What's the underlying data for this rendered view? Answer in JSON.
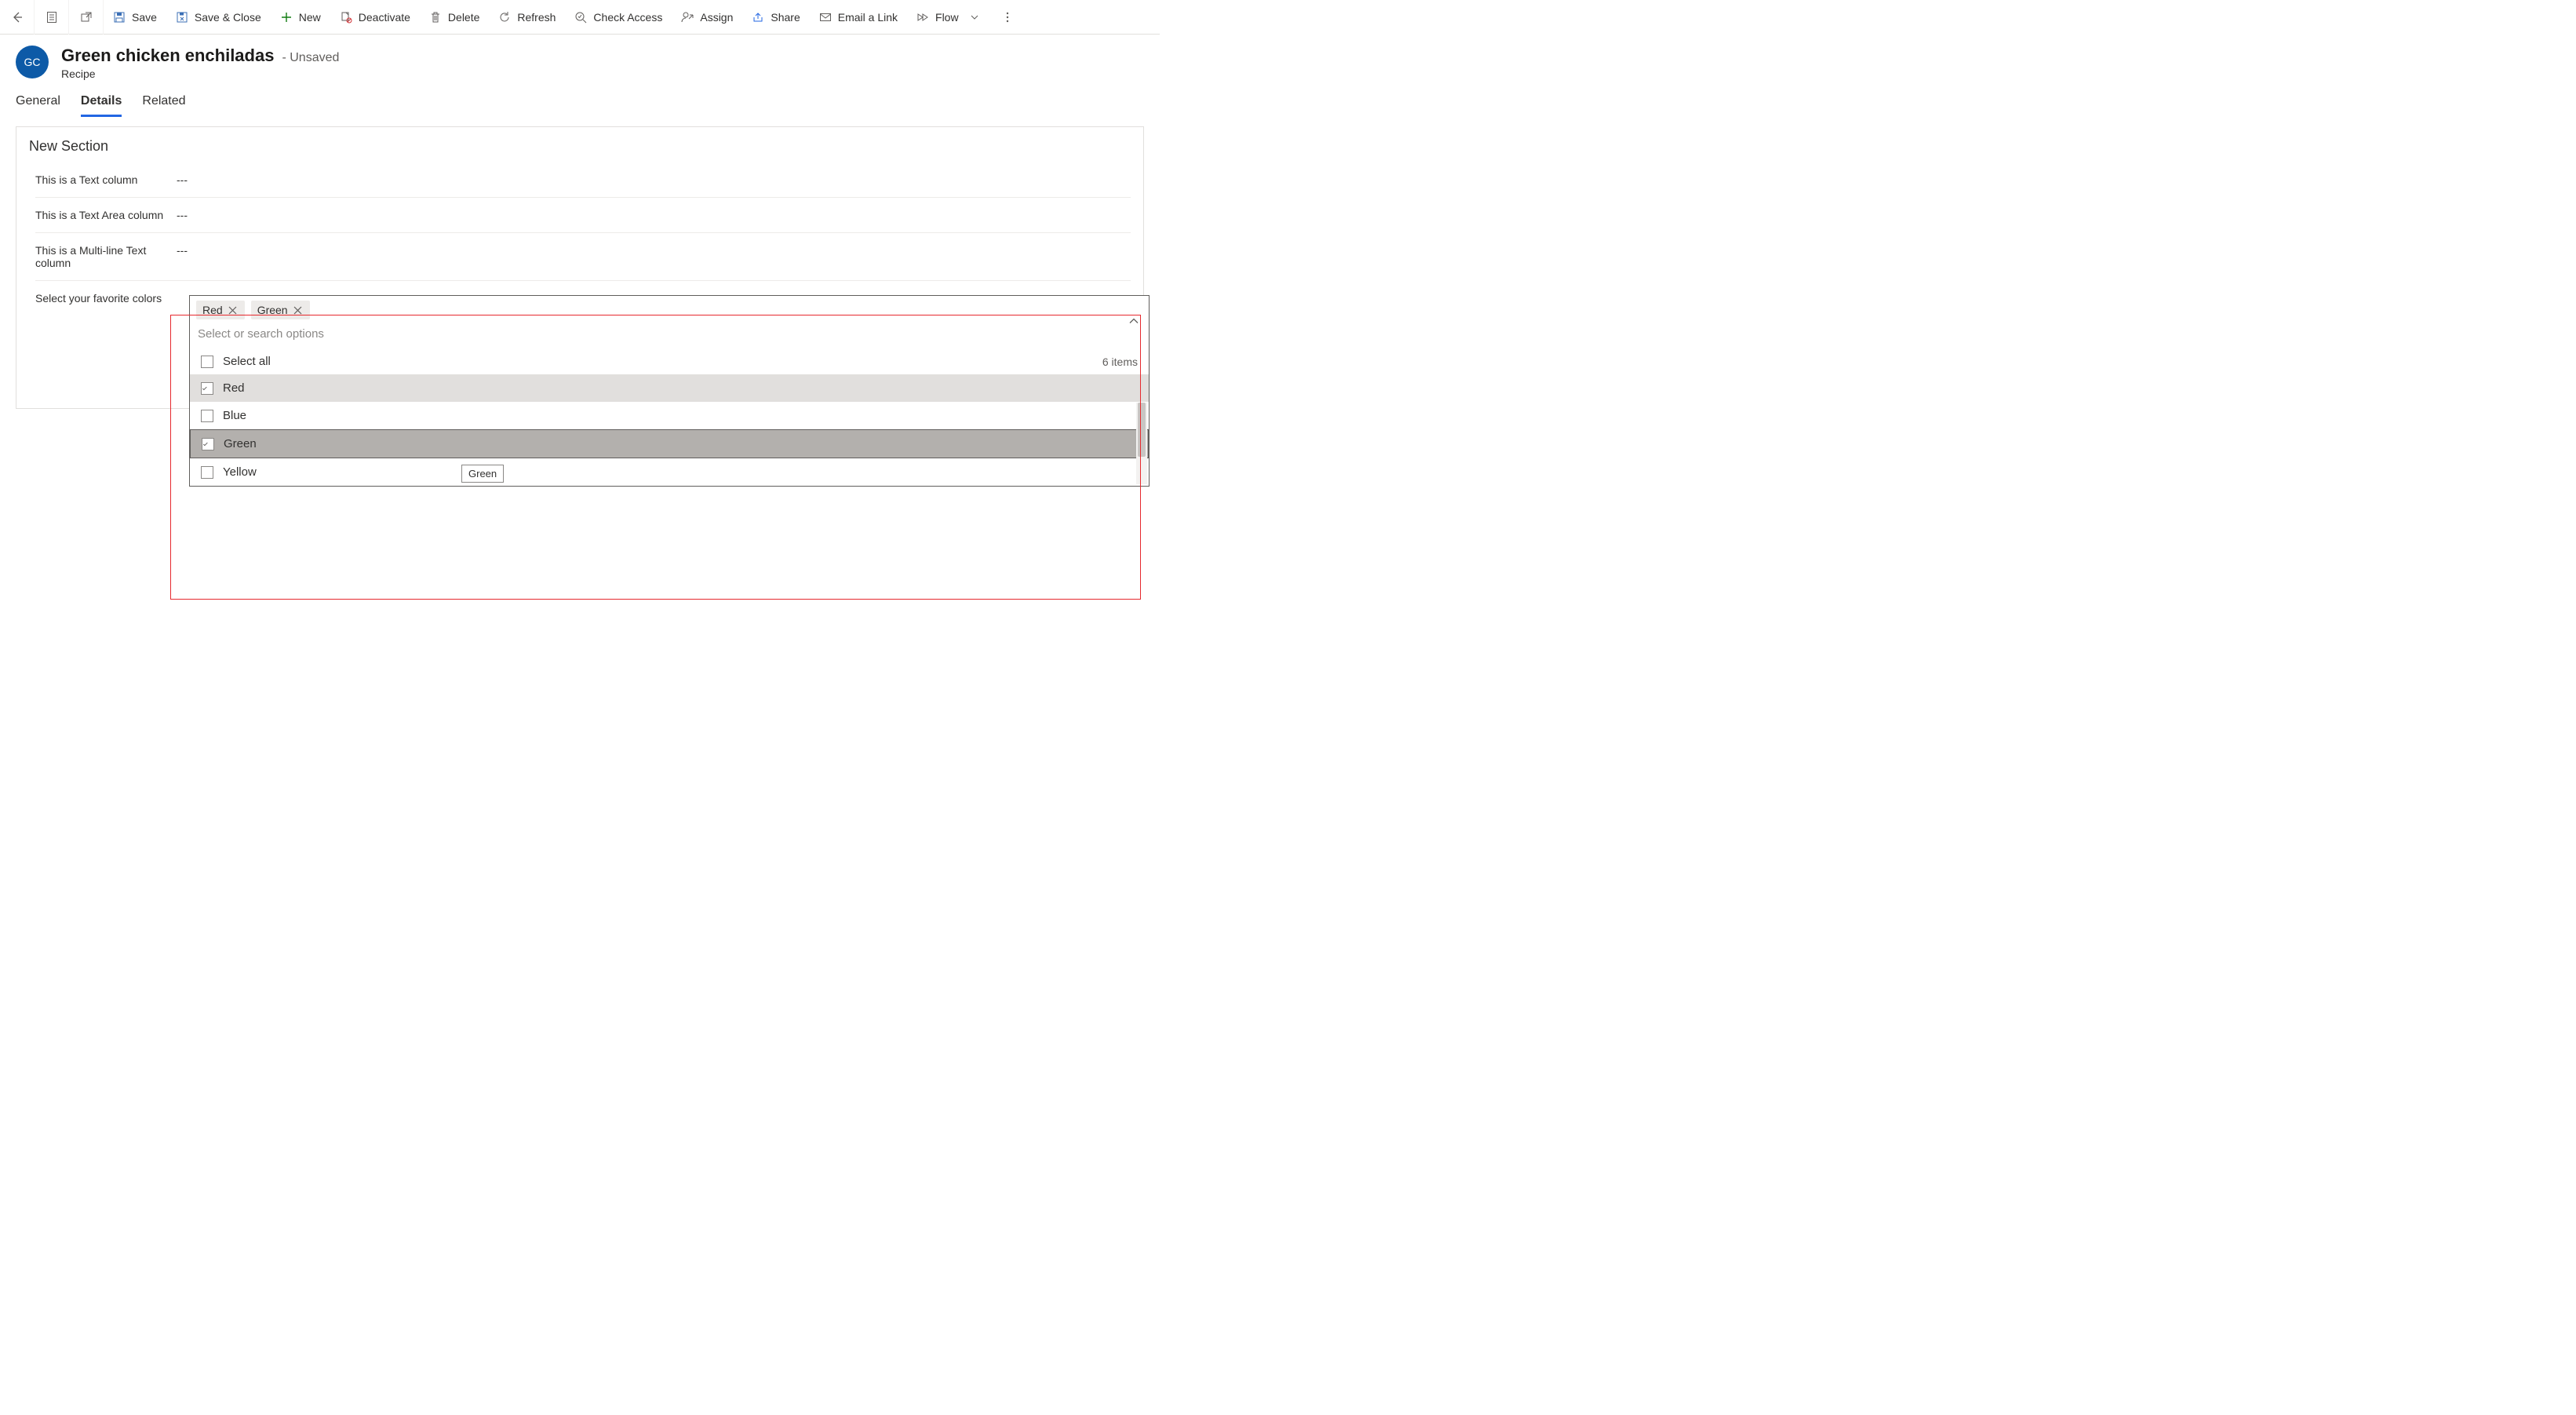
{
  "commandbar": {
    "save": "Save",
    "save_close": "Save & Close",
    "new": "New",
    "deactivate": "Deactivate",
    "delete": "Delete",
    "refresh": "Refresh",
    "check_access": "Check Access",
    "assign": "Assign",
    "share": "Share",
    "email_link": "Email a Link",
    "flow": "Flow"
  },
  "header": {
    "avatar_initials": "GC",
    "title": "Green chicken enchiladas",
    "status": "- Unsaved",
    "entity": "Recipe"
  },
  "tabs": {
    "general": "General",
    "details": "Details",
    "related": "Related"
  },
  "section": {
    "title": "New Section",
    "fields": {
      "text_label": "This is a Text column",
      "text_value": "---",
      "textarea_label": "This is a Text Area column",
      "textarea_value": "---",
      "multiline_label": "This is a Multi-line Text column",
      "multiline_value": "---",
      "colors_label": "Select your favorite colors"
    }
  },
  "multiselect": {
    "pills": [
      {
        "label": "Red"
      },
      {
        "label": "Green"
      }
    ],
    "placeholder": "Select or search options",
    "select_all": "Select all",
    "count_text": "6 items",
    "options": [
      {
        "label": "Red",
        "checked": true,
        "state": "selected"
      },
      {
        "label": "Blue",
        "checked": false,
        "state": ""
      },
      {
        "label": "Green",
        "checked": true,
        "state": "focused"
      },
      {
        "label": "Yellow",
        "checked": false,
        "state": ""
      }
    ],
    "tooltip": "Green"
  }
}
